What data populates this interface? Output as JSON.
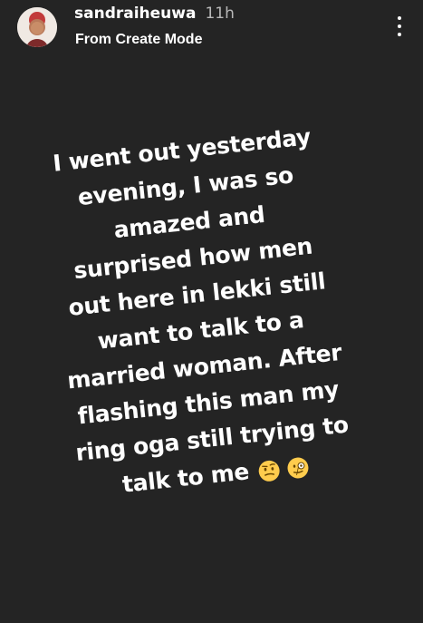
{
  "header": {
    "username": "sandraiheuwa",
    "time": "11h",
    "subtitle": "From Create Mode"
  },
  "icons": {
    "avatar": "profile-avatar",
    "more": "more-vertical-icon",
    "emoji_1": "face-with-raised-eyebrow-emoji",
    "emoji_2": "face-with-monocle-emoji"
  },
  "story": {
    "lines": [
      "I went out yesterday",
      "evening, I was so",
      "amazed and",
      "surprised how men",
      "out here in lekki still",
      "want to talk to a",
      "married woman. After",
      "flashing this man my",
      "ring oga still trying to",
      "talk to me"
    ]
  },
  "colors": {
    "background": "#242424",
    "text": "#ffffff",
    "time_text": "#b8b8b8"
  }
}
